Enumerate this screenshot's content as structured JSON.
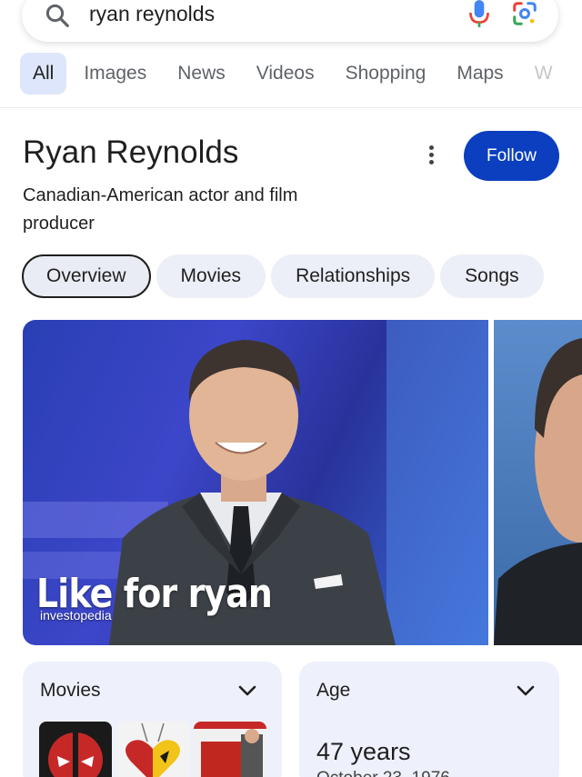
{
  "search": {
    "query": "ryan reynolds"
  },
  "tabs": [
    {
      "label": "All",
      "active": true
    },
    {
      "label": "Images"
    },
    {
      "label": "News"
    },
    {
      "label": "Videos"
    },
    {
      "label": "Shopping"
    },
    {
      "label": "Maps"
    },
    {
      "label": "W"
    }
  ],
  "panel": {
    "title": "Ryan Reynolds",
    "subtitle": "Canadian-American actor and film producer",
    "follow_label": "Follow"
  },
  "chips": [
    {
      "label": "Overview",
      "selected": true
    },
    {
      "label": "Movies"
    },
    {
      "label": "Relationships"
    },
    {
      "label": "Songs"
    }
  ],
  "images": {
    "main_overlay": "Like for ryan",
    "main_source": "investopedia"
  },
  "cards": {
    "movies": {
      "title": "Movies"
    },
    "age": {
      "title": "Age",
      "value": "47 years",
      "date": "October 23, 1976"
    }
  },
  "icons": {
    "search": "search-icon",
    "mic": "microphone-icon",
    "lens": "google-lens-icon",
    "more": "more-vert-icon",
    "chevron": "chevron-down-icon"
  },
  "colors": {
    "follow_bg": "#0b3fbf",
    "active_tab_bg": "#dde6fa",
    "card_bg": "#eef1fb"
  }
}
